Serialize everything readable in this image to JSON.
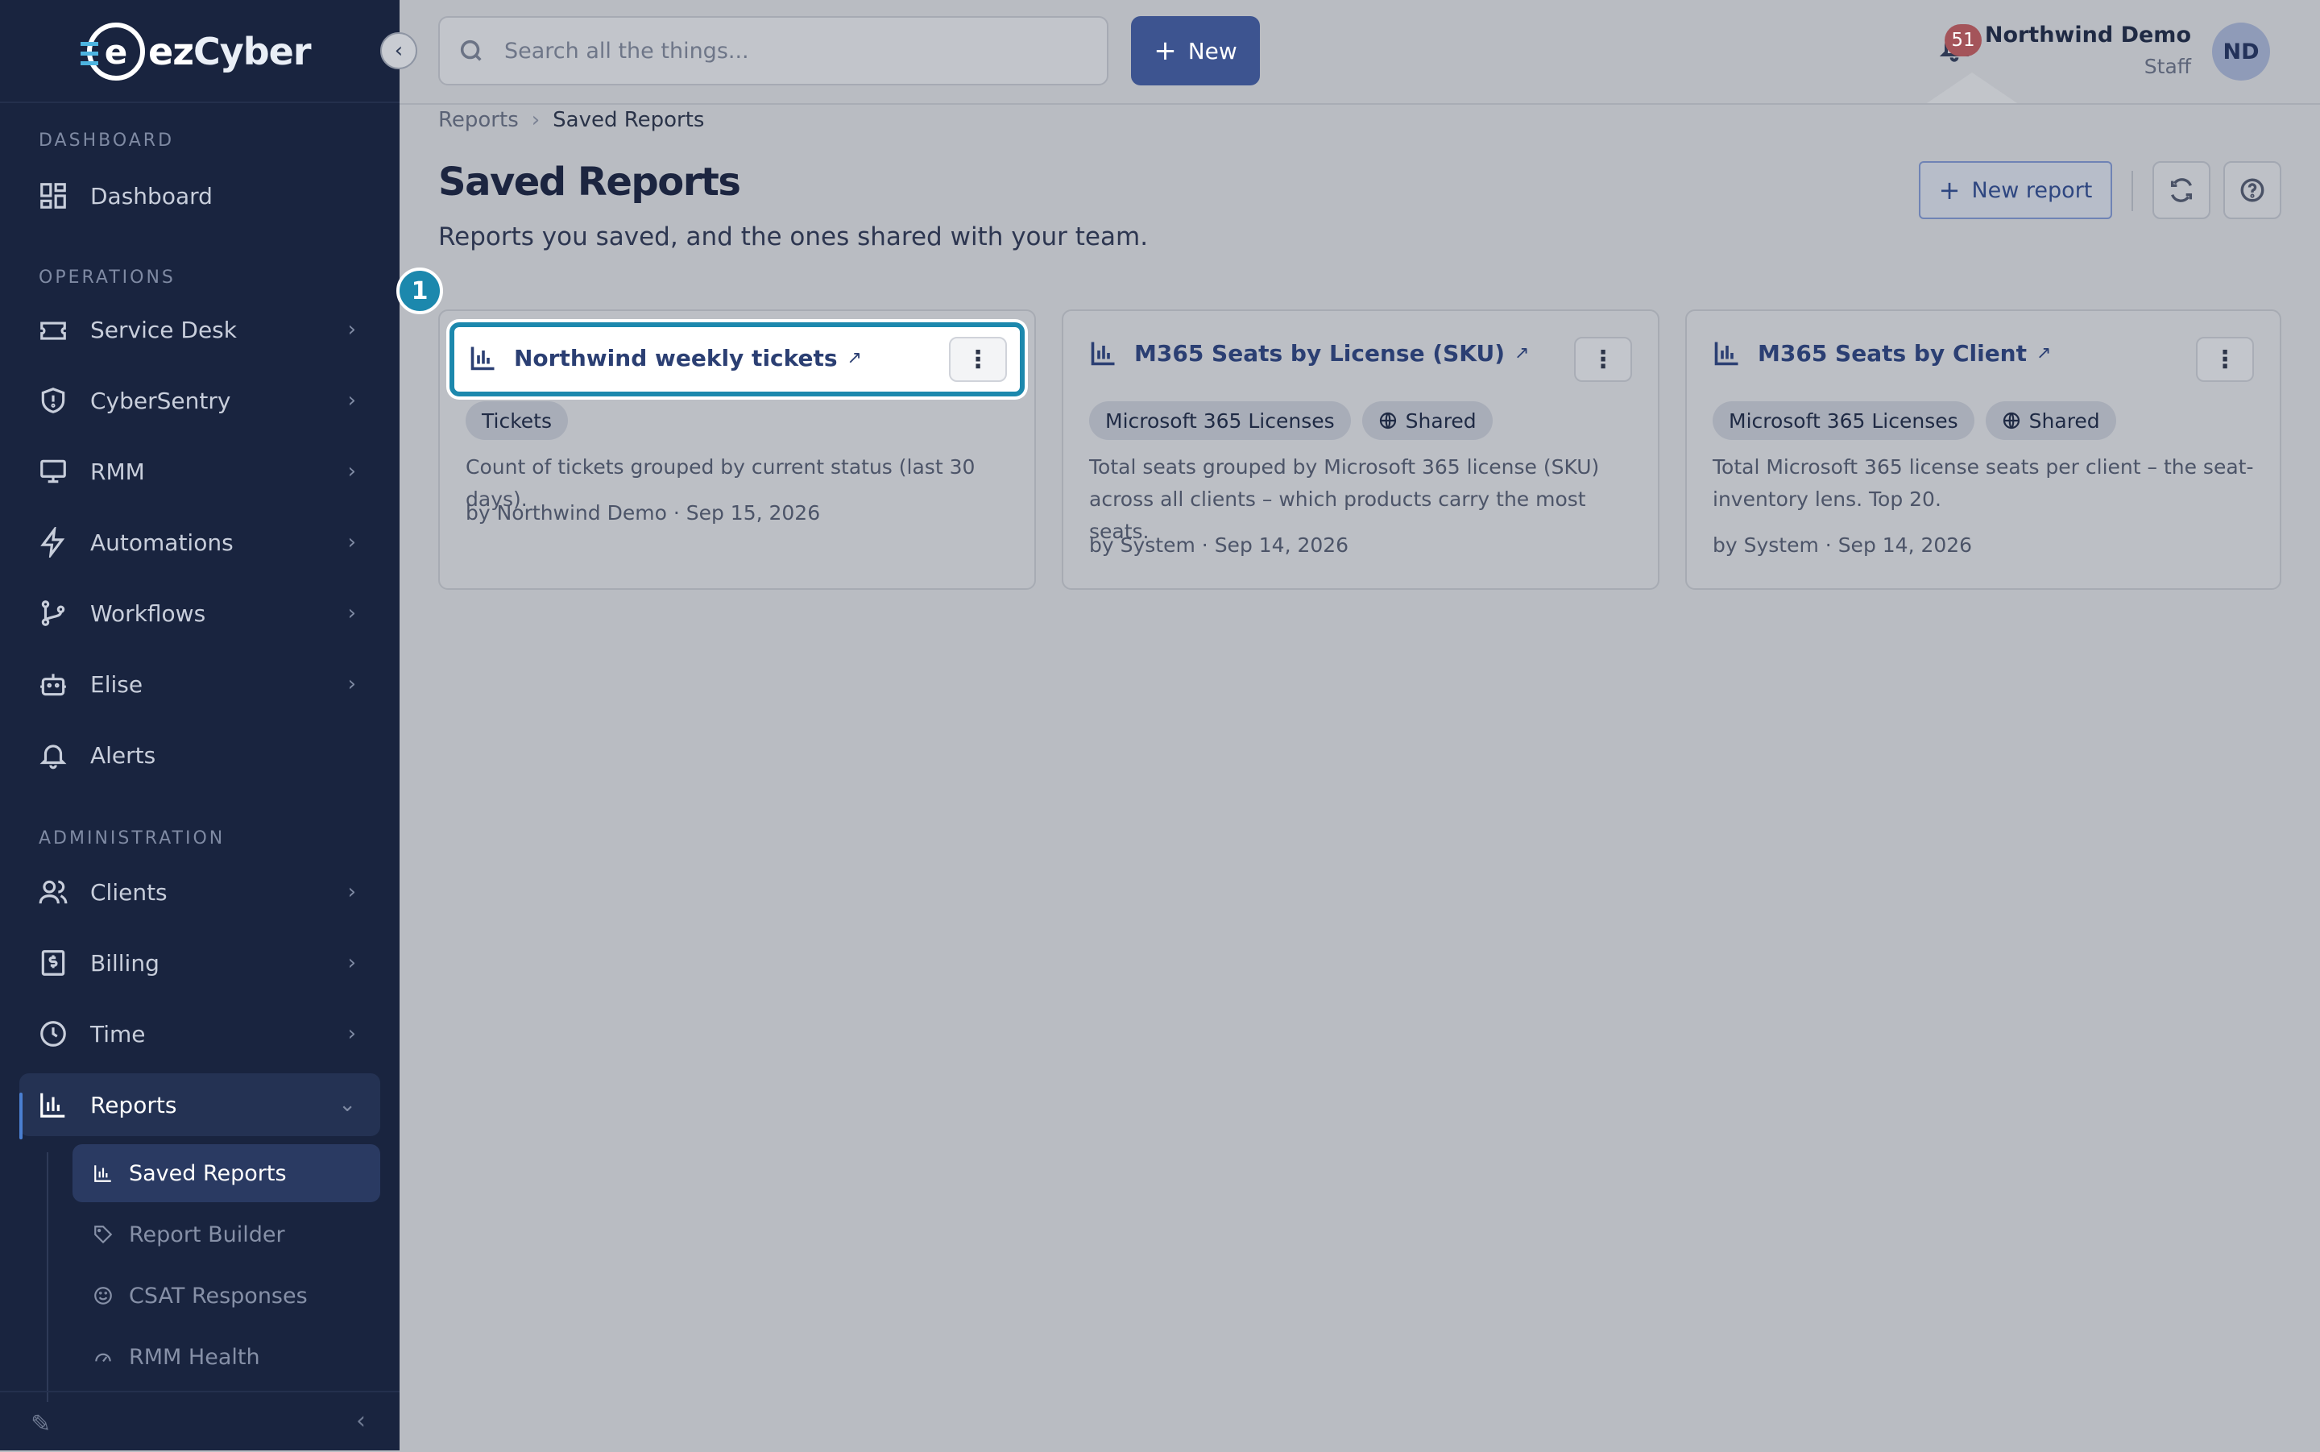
{
  "brand": {
    "logo_letter": "e",
    "logo_text_ez": "ez",
    "logo_text_cyber": "Cyber"
  },
  "sidebar": {
    "sections": {
      "dashboard": "DASHBOARD",
      "operations": "OPERATIONS",
      "administration": "ADMINISTRATION"
    },
    "items": [
      {
        "label": "Dashboard",
        "icon": "grid-icon"
      },
      {
        "label": "Service Desk",
        "icon": "ticket-icon"
      },
      {
        "label": "CyberSentry",
        "icon": "shield-icon"
      },
      {
        "label": "RMM",
        "icon": "monitor-icon"
      },
      {
        "label": "Automations",
        "icon": "bolt-icon"
      },
      {
        "label": "Workflows",
        "icon": "branch-icon"
      },
      {
        "label": "Elise",
        "icon": "bot-icon"
      },
      {
        "label": "Alerts",
        "icon": "bell-icon"
      },
      {
        "label": "Clients",
        "icon": "users-icon"
      },
      {
        "label": "Billing",
        "icon": "dollar-icon"
      },
      {
        "label": "Time",
        "icon": "clock-icon"
      },
      {
        "label": "Reports",
        "icon": "chart-icon"
      }
    ],
    "sub_items": [
      {
        "label": "Saved Reports",
        "icon": "chart-icon"
      },
      {
        "label": "Report Builder",
        "icon": "tag-icon"
      },
      {
        "label": "CSAT Responses",
        "icon": "smile-icon"
      },
      {
        "label": "RMM Health",
        "icon": "gauge-icon"
      }
    ]
  },
  "topbar": {
    "search_placeholder": "Search all the things...",
    "new_label": "New",
    "notification_count": "51",
    "user_name": "Northwind Demo",
    "user_role": "Staff",
    "avatar_initials": "ND"
  },
  "breadcrumb": {
    "root": "Reports",
    "current": "Saved Reports"
  },
  "page": {
    "title": "Saved Reports",
    "subtitle": "Reports you saved, and the ones shared with your team.",
    "new_report_label": "New report"
  },
  "cards": [
    {
      "title": "Northwind weekly tickets",
      "tags": [
        "Tickets"
      ],
      "description": "Count of tickets grouped by current status (last 30 days).",
      "meta_by": "by Northwind Demo",
      "meta_date": "Sep 15, 2026"
    },
    {
      "title": "M365 Seats by License (SKU)",
      "tags": [
        "Microsoft 365 Licenses"
      ],
      "shared_label": "Shared",
      "description": "Total seats grouped by Microsoft 365 license (SKU) across all clients – which products carry the most seats.",
      "meta_by": "by System",
      "meta_date": "Sep 14, 2026"
    },
    {
      "title": "M365 Seats by Client",
      "tags": [
        "Microsoft 365 Licenses"
      ],
      "shared_label": "Shared",
      "description": "Total Microsoft 365 license seats per client – the seat-inventory lens. Top 20.",
      "meta_by": "by System",
      "meta_date": "Sep 14, 2026"
    }
  ],
  "tutorial": {
    "step_number": "1"
  },
  "colors": {
    "sidebar_bg": "#19243f",
    "accent": "#3d5490",
    "highlight": "#1c88ad",
    "badge": "#a4545a"
  }
}
